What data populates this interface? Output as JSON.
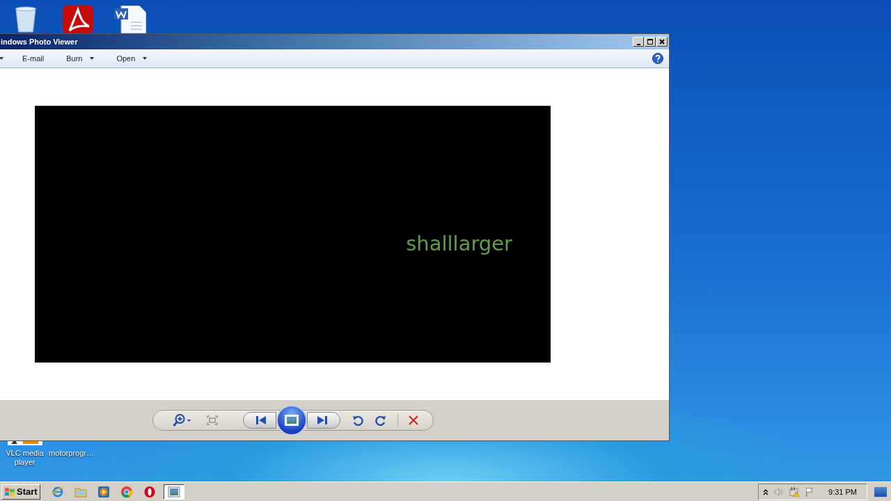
{
  "desktop": {
    "icons": [
      {
        "label": "VLC media player"
      },
      {
        "label": "motorprogr…"
      }
    ]
  },
  "window": {
    "title": "indows Photo Viewer",
    "toolbar": [
      {
        "label": "E-mail",
        "dropdown": false
      },
      {
        "label": "Burn",
        "dropdown": true
      },
      {
        "label": "Open",
        "dropdown": true
      }
    ],
    "image_text": "shalllarger"
  },
  "taskbar": {
    "start": "Start",
    "apps": [
      {
        "kind": "ie",
        "selected": false
      },
      {
        "kind": "folder",
        "selected": false
      },
      {
        "kind": "media",
        "selected": false
      },
      {
        "kind": "chrome",
        "selected": false
      },
      {
        "kind": "opera",
        "selected": false
      },
      {
        "kind": "photo",
        "selected": true
      }
    ],
    "clock": "9:31 PM"
  }
}
